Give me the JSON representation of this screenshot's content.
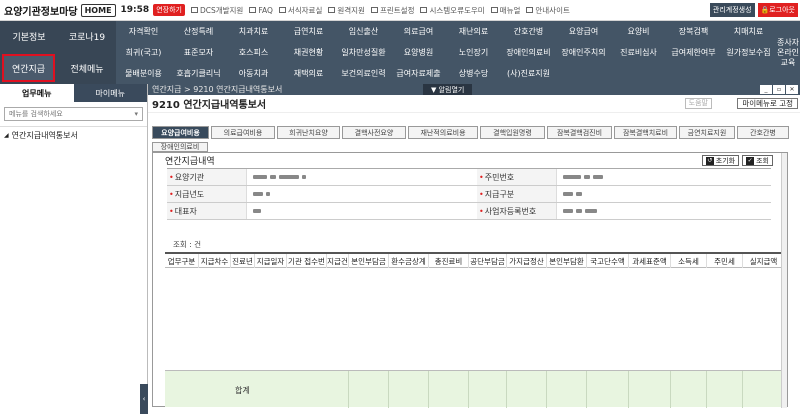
{
  "topbar": {
    "title": "요양기관정보마당",
    "home_label": "HOME",
    "time": "19:58",
    "extend_label": "연장하기",
    "links": [
      "DCS개발지원",
      "FAQ",
      "서식자료실",
      "원격지원",
      "프린트설정",
      "시스템오류도우미",
      "매뉴얼",
      "안내사이트"
    ],
    "manage_label": "관리계정생성",
    "logout_label": "로그아웃"
  },
  "menu": {
    "left": {
      "basic": "기본정보",
      "corona": "코로나19",
      "year_end": "연간지급",
      "all": "전체메뉴"
    },
    "row1": [
      "자격확인",
      "산정특례",
      "치과치료",
      "급연치료",
      "임신출산",
      "의료급여",
      "재난의료",
      "간호간병",
      "요양급여",
      "요양비",
      "장복검팩",
      "치매치료"
    ],
    "row2": [
      "희귀(국고)",
      "표준모자",
      "호스피스",
      "채권현황",
      "일차만성질환",
      "요양병원",
      "노인장기",
      "장애인의료비",
      "장애인주치의",
      "진료비심사",
      "급여제한여부",
      "원가정보수집"
    ],
    "row3": [
      "물배분이용",
      "호흡기클리닉",
      "아동치과",
      "재택의료",
      "보건의료인력",
      "급여자료제출",
      "상병수당",
      "(사)진료지원"
    ],
    "side": "종사자 온라인 교육"
  },
  "left_pane": {
    "tab_work": "업무메뉴",
    "tab_my": "마이메뉴",
    "search_placeholder": "메뉴를 검색하세요",
    "tree_item": "연간지급내역통보서"
  },
  "main": {
    "breadcrumb": "연간지급 > 9210 연간지급내역통보서",
    "alert_label": "▼ 알림열기",
    "page_title": "9210 연간지급내역통보서",
    "help_label": "도움말",
    "myfix_label": "마이메뉴로 고정",
    "tabs": [
      "요양급여비용",
      "의료급여비용",
      "희귀난치요양",
      "결핵사전요양",
      "재난적의료비용",
      "결핵입원명령",
      "잠복결핵검진비",
      "잠복결핵치료비",
      "금연치료지원",
      "간호간병"
    ],
    "tab_row2": "장애인의료비",
    "section_title": "연간지급내역",
    "reset_label": "초기화",
    "query_label": "조회",
    "form": {
      "org_label": "요양기관",
      "rrn_label": "주민번호",
      "year_label": "지급년도",
      "type_label": "지급구분",
      "rep_label": "대표자",
      "bizno_label": "사업자등록번호"
    },
    "count_text": "조회 : 건",
    "grid_headers": [
      "업무구분",
      "지급차수",
      "진료년",
      "지급일자",
      "기관 접수번",
      "지급건",
      "본인부담금",
      "환수금상계",
      "총진료비",
      "공단부담금",
      "가지급정산",
      "본인부담환",
      "국고단수액",
      "과세표준액",
      "소득세",
      "주민세",
      "실지급액"
    ],
    "total_label": "합계"
  }
}
